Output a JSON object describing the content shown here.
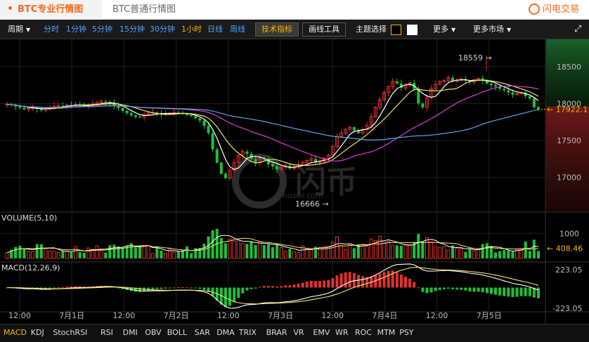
{
  "tabs": [
    {
      "label": "BTC专业行情图"
    },
    {
      "label": "BTC普通行情图"
    }
  ],
  "brand": "闪电交易",
  "toolbar": {
    "period_label": "周期",
    "periods": [
      "分时",
      "1分钟",
      "5分钟",
      "15分钟",
      "30分钟",
      "1小时",
      "日线",
      "周线"
    ],
    "active_period": "1小时",
    "tech_indicator": "技术指标",
    "draw_tools": "画线工具",
    "theme_label": "主题选择",
    "more": "更多",
    "more_markets": "更多市场"
  },
  "price_axis": [
    "18500",
    "18000",
    "17500",
    "17000"
  ],
  "current_price": "17922.1",
  "high_marker": "18559 →",
  "low_marker": "16666 →",
  "watermark": "huobi.com",
  "volume": {
    "label": "VOLUME(5,10)",
    "axis": [
      "1000"
    ],
    "current": "408.46"
  },
  "macd": {
    "label": "MACD(12,26,9)",
    "axis_top": "223.05",
    "axis_bottom": "-223.05"
  },
  "time_axis": [
    "12:00",
    "7月1日",
    "12:00",
    "7月2日",
    "12:00",
    "7月3日",
    "12:00",
    "7月4日",
    "12:00",
    "7月5日"
  ],
  "indicators": [
    "MACD",
    "KDJ",
    "StochRSI",
    "RSI",
    "DMI",
    "OBV",
    "BOLL",
    "SAR",
    "DMA",
    "TRIX",
    "BRAR",
    "VR",
    "EMV",
    "WR",
    "ROC",
    "MTM",
    "PSY"
  ],
  "active_indicator": "MACD",
  "colors": {
    "up": "#e03030",
    "down": "#1dbf3a",
    "ma5": "#ffffff",
    "ma10": "#f2e45c",
    "ma30": "#d641d6",
    "ma60": "#5aa8e8",
    "accent": "#f06b1e"
  },
  "chart_data": {
    "type": "candlestick",
    "timeframe": "1小时",
    "ylim": [
      16550,
      18850
    ],
    "closes": [
      17990,
      17985,
      17960,
      17940,
      17920,
      17935,
      17950,
      17930,
      17910,
      17925,
      17945,
      17960,
      17970,
      17965,
      17980,
      17975,
      17990,
      17985,
      17970,
      17980,
      17995,
      18010,
      18030,
      18020,
      18000,
      17975,
      17940,
      17900,
      17870,
      17840,
      17820,
      17815,
      17850,
      17870,
      17880,
      17870,
      17850,
      17860,
      17870,
      17880,
      17870,
      17860,
      17845,
      17830,
      17800,
      17770,
      17700,
      17600,
      17380,
      17200,
      17050,
      16990,
      17100,
      17200,
      17300,
      17350,
      17320,
      17250,
      17200,
      17260,
      17250,
      17180,
      17150,
      17110,
      17140,
      17160,
      17120,
      17150,
      17170,
      17200,
      17230,
      17250,
      17200,
      17220,
      17260,
      17300,
      17420,
      17550,
      17600,
      17650,
      17680,
      17640,
      17600,
      17650,
      17700,
      17820,
      17950,
      18050,
      18150,
      18230,
      18300,
      18270,
      18210,
      18250,
      18280,
      18200,
      18000,
      17950,
      18080,
      18200,
      18260,
      18300,
      18310,
      18350,
      18300,
      18320,
      18330,
      18310,
      18290,
      18320,
      18340,
      18310,
      18270,
      18250,
      18230,
      18200,
      18180,
      18150,
      18120,
      18140,
      18150,
      18100,
      18070,
      17950,
      17922
    ]
  }
}
